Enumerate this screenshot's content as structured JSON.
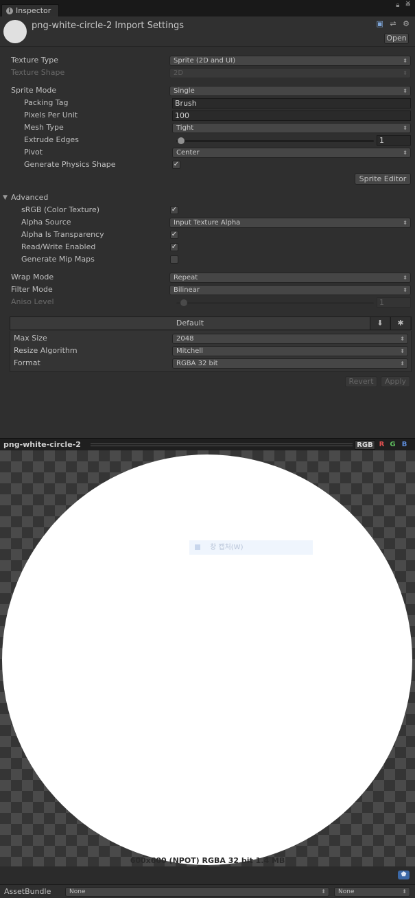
{
  "window": {
    "tab_label": "Inspector",
    "tab_icon": "info-icon"
  },
  "header": {
    "title": "png-white-circle-2 Import Settings",
    "open_label": "Open"
  },
  "settings": {
    "texture_type": {
      "label": "Texture Type",
      "value": "Sprite (2D and UI)"
    },
    "texture_shape": {
      "label": "Texture Shape",
      "value": "2D"
    },
    "sprite_mode": {
      "label": "Sprite Mode",
      "value": "Single"
    },
    "packing_tag": {
      "label": "Packing Tag",
      "value": "Brush"
    },
    "pixels_per_unit": {
      "label": "Pixels Per Unit",
      "value": "100"
    },
    "mesh_type": {
      "label": "Mesh Type",
      "value": "Tight"
    },
    "extrude_edges": {
      "label": "Extrude Edges",
      "value": "1"
    },
    "pivot": {
      "label": "Pivot",
      "value": "Center"
    },
    "generate_physics_shape": {
      "label": "Generate Physics Shape",
      "checked": true
    },
    "sprite_editor_label": "Sprite Editor"
  },
  "advanced": {
    "label": "Advanced",
    "srgb": {
      "label": "sRGB (Color Texture)",
      "checked": true
    },
    "alpha_source": {
      "label": "Alpha Source",
      "value": "Input Texture Alpha"
    },
    "alpha_is_transparency": {
      "label": "Alpha Is Transparency",
      "checked": true
    },
    "read_write": {
      "label": "Read/Write Enabled",
      "checked": true
    },
    "mip_maps": {
      "label": "Generate Mip Maps",
      "checked": false
    }
  },
  "sampling": {
    "wrap_mode": {
      "label": "Wrap Mode",
      "value": "Repeat"
    },
    "filter_mode": {
      "label": "Filter Mode",
      "value": "Bilinear"
    },
    "aniso_level": {
      "label": "Aniso Level",
      "value": "1"
    }
  },
  "platform": {
    "tab_label": "Default",
    "max_size": {
      "label": "Max Size",
      "value": "2048"
    },
    "resize_algorithm": {
      "label": "Resize Algorithm",
      "value": "Mitchell"
    },
    "format": {
      "label": "Format",
      "value": "RGBA 32 bit"
    },
    "revert_label": "Revert",
    "apply_label": "Apply"
  },
  "preview": {
    "title": "png-white-circle-2",
    "channels": {
      "rgb": "RGB",
      "r": "R",
      "g": "G",
      "b": "B"
    },
    "overlay_text": "창 캡처(W)",
    "info": "600x600 (NPOT)  RGBA 32 bit   1.4 MB"
  },
  "asset_bundle": {
    "label": "AssetBundle",
    "name": "None",
    "variant": "None"
  },
  "colors": {
    "panel_bg": "#2f2f2f",
    "dark_bar": "#1f1f1f",
    "channel_r": "#e05050",
    "channel_g": "#5fbf5f",
    "channel_b": "#5f8fdf",
    "tag_blue": "#3b68a6"
  }
}
